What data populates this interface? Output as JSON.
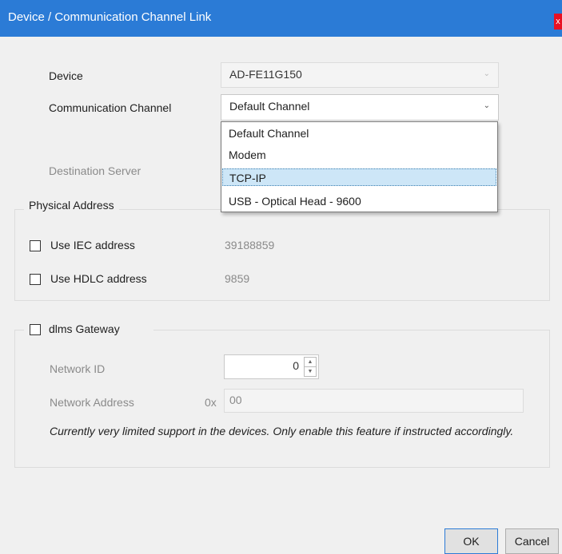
{
  "window": {
    "title": "Device / Communication Channel Link",
    "close_label": "x"
  },
  "form": {
    "device": {
      "label": "Device",
      "value": "AD-FE11G150"
    },
    "channel": {
      "label": "Communication Channel",
      "value": "Default Channel",
      "options": [
        "Default Channel",
        "Modem",
        "TCP-IP",
        "USB - Optical Head - 9600"
      ],
      "highlighted": "TCP-IP"
    },
    "destination": {
      "label": "Destination Server"
    }
  },
  "physical_address": {
    "title": "Physical Address",
    "iec": {
      "label": "Use IEC address",
      "value": "39188859",
      "checked": false
    },
    "hdlc": {
      "label": "Use HDLC address",
      "value": "9859",
      "checked": false
    }
  },
  "gateway": {
    "label": "dlms Gateway",
    "checked": false,
    "network_id": {
      "label": "Network ID",
      "value": "0"
    },
    "network_address": {
      "label": "Network Address",
      "prefix": "0x",
      "value": "00"
    },
    "note": "Currently very limited support in the devices. Only enable this feature if instructed accordingly."
  },
  "buttons": {
    "ok": "OK",
    "cancel": "Cancel"
  },
  "colors": {
    "titlebar": "#2b7bd6",
    "selection": "#cde6f7"
  }
}
